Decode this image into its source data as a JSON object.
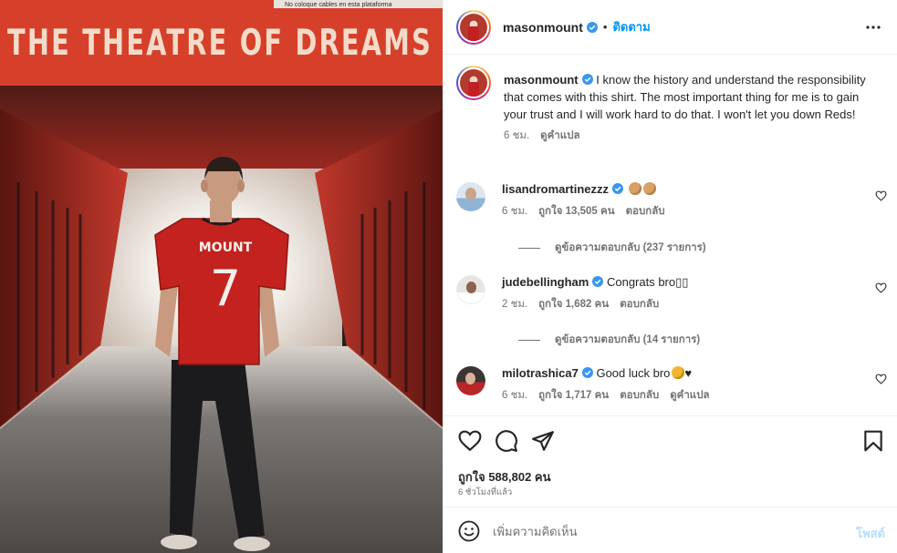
{
  "photo": {
    "sign_text": "THE THEATRE OF DREAMS",
    "sign_subtext": "No coloque cables en esta plataforma",
    "jersey_name": "MOUNT",
    "jersey_number": "7"
  },
  "header": {
    "username": "masonmount",
    "separator": "•",
    "follow_label": "ติดตาม"
  },
  "caption": {
    "username": "masonmount",
    "text": "I know the history and understand the responsibility that comes with this shirt. The most important thing for me is to gain your trust and I will work hard to do that. I won't let you down Reds!",
    "time": "6 ชม.",
    "translate_label": "ดูคำแปล"
  },
  "comments": [
    {
      "username": "lisandromartinezzz",
      "text": "",
      "time": "6 ชม.",
      "likes": "ถูกใจ 13,505 คน",
      "reply_label": "ตอบกลับ",
      "view_replies": "ดูข้อความตอบกลับ (237 รายการ)"
    },
    {
      "username": "judebellingham",
      "text": "Congrats bro▯▯",
      "time": "2 ชม.",
      "likes": "ถูกใจ 1,682 คน",
      "reply_label": "ตอบกลับ",
      "view_replies": "ดูข้อความตอบกลับ (14 รายการ)"
    },
    {
      "username": "milotrashica7",
      "text": "Good luck bro",
      "text_suffix": "♥",
      "time": "6 ชม.",
      "likes": "ถูกใจ 1,717 คน",
      "reply_label": "ตอบกลับ",
      "translate_label": "ดูคำแปล"
    }
  ],
  "post": {
    "likes": "ถูกใจ 588,802 คน",
    "time": "6 ชั่วโมงที่แล้ว"
  },
  "composer": {
    "placeholder": "เพิ่มความคิดเห็น",
    "post_label": "โพสต์"
  },
  "icons": {
    "verified": "verified-badge-icon",
    "more": "more-options-icon",
    "like": "heart-icon",
    "comment": "comment-icon",
    "share": "send-icon",
    "save": "bookmark-icon",
    "emoji": "smile-icon"
  },
  "colors": {
    "accent": "#0095f6",
    "verified": "#3897f0",
    "muted": "#737373",
    "post_disabled": "#b2dffc",
    "sign_red": "#d6402b"
  }
}
